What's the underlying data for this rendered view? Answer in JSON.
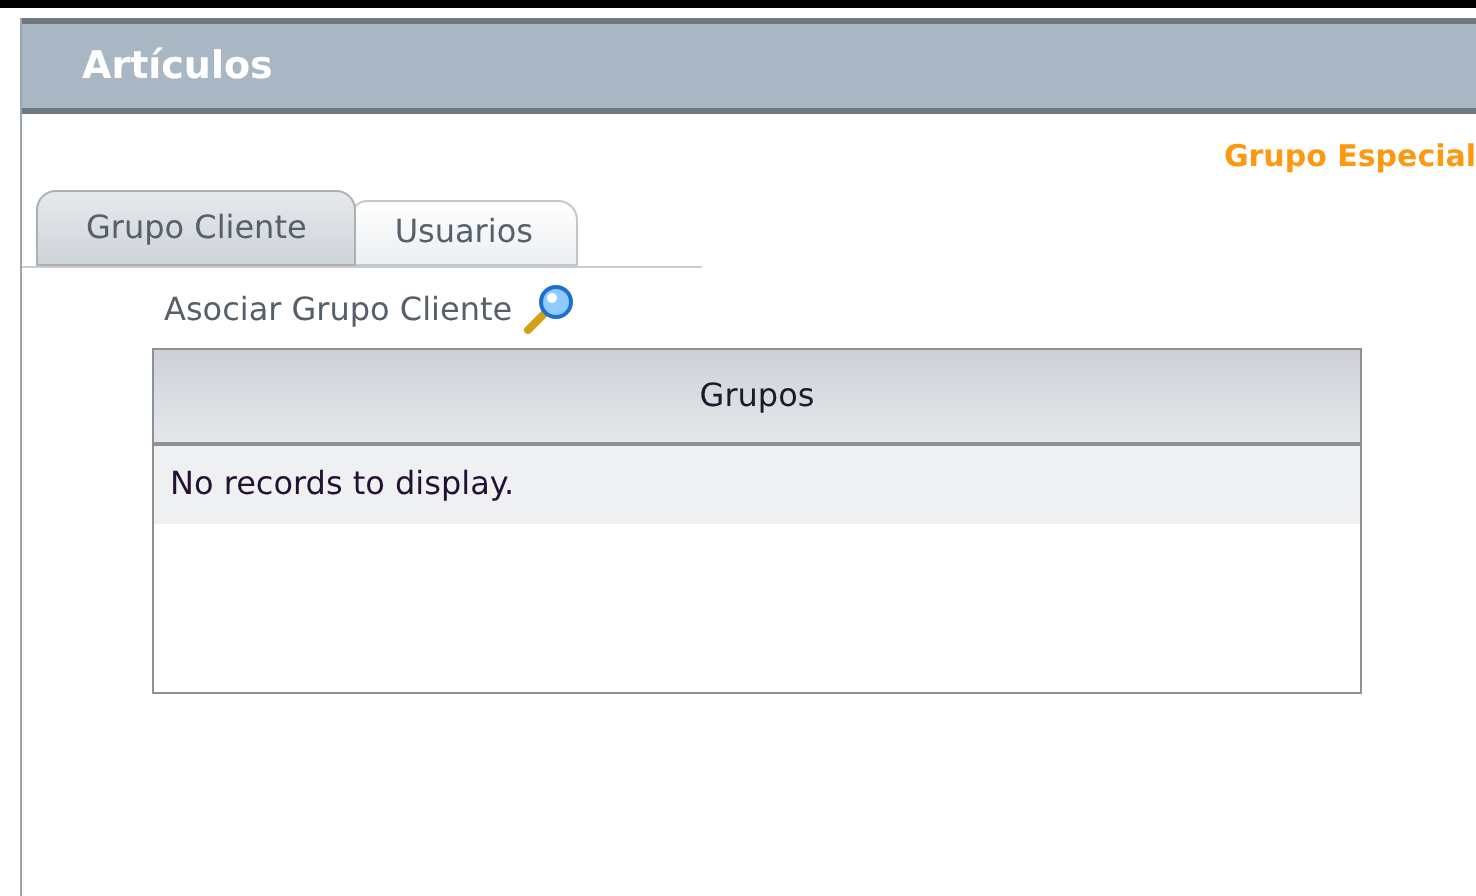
{
  "panel": {
    "title": "Artículos"
  },
  "group_label": "Grupo Especial",
  "tabs": [
    {
      "label": "Grupo Cliente",
      "selected": true
    },
    {
      "label": "Usuarios",
      "selected": false
    }
  ],
  "link": {
    "label": "Asociar Grupo Cliente"
  },
  "table": {
    "columns": [
      "Grupos"
    ],
    "empty_message": "No records to display."
  }
}
